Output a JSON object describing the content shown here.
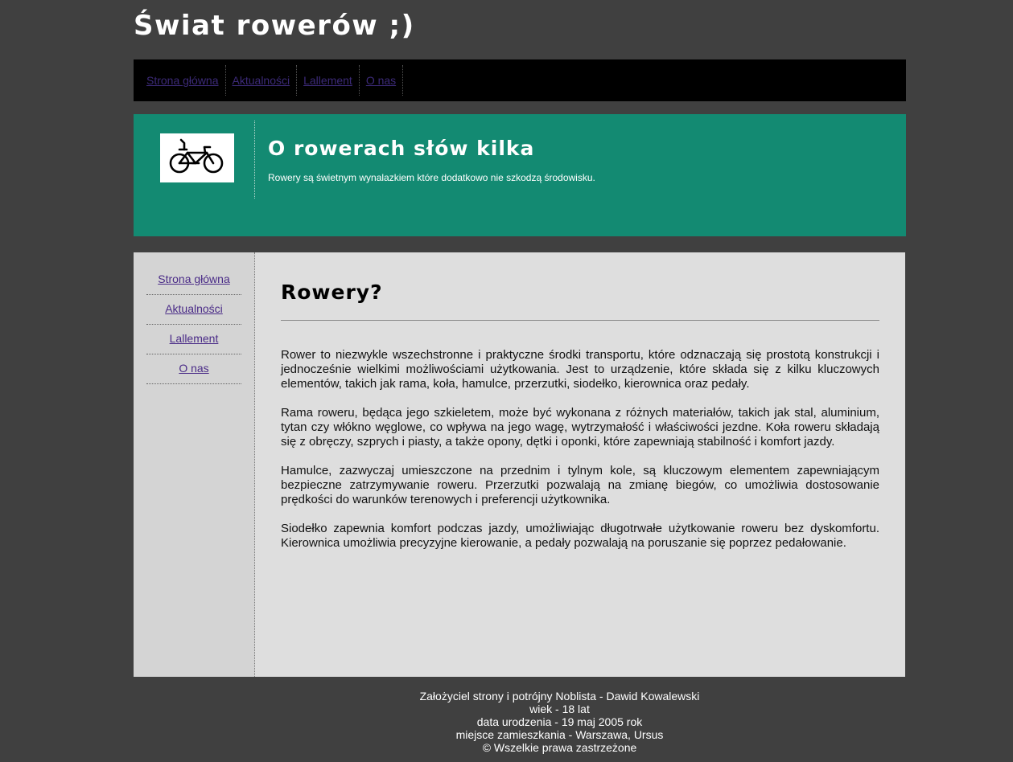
{
  "site": {
    "title": "Świat rowerów ;)"
  },
  "top_nav": {
    "items": [
      {
        "label": "Strona główna"
      },
      {
        "label": "Aktualności"
      },
      {
        "label": "Lallement"
      },
      {
        "label": "O nas"
      }
    ]
  },
  "banner": {
    "logo_icon": "bicycle-icon",
    "heading": "O rowerach słów kilka",
    "text": "Rowery są świetnym wynalazkiem które dodatkowo nie szkodzą środowisku."
  },
  "sidebar": {
    "items": [
      {
        "label": "Strona główna"
      },
      {
        "label": "Aktualności"
      },
      {
        "label": "Lallement"
      },
      {
        "label": "O nas"
      }
    ]
  },
  "main": {
    "heading": "Rowery?",
    "paragraphs": [
      "Rower to niezwykle wszechstronne i praktyczne środki transportu, które odznaczają się prostotą konstrukcji i jednocześnie wielkimi możliwościami użytkowania. Jest to urządzenie, które składa się z kilku kluczowych elementów, takich jak rama, koła, hamulce, przerzutki, siodełko, kierownica oraz pedały.",
      "Rama roweru, będąca jego szkieletem, może być wykonana z różnych materiałów, takich jak stal, aluminium, tytan czy włókno węglowe, co wpływa na jego wagę, wytrzymałość i właściwości jezdne. Koła roweru składają się z obręczy, szprych i piasty, a także opony, dętki i oponki, które zapewniają stabilność i komfort jazdy.",
      "Hamulce, zazwyczaj umieszczone na przednim i tylnym kole, są kluczowym elementem zapewniającym bezpieczne zatrzymywanie roweru. Przerzutki pozwalają na zmianę biegów, co umożliwia dostosowanie prędkości do warunków terenowych i preferencji użytkownika.",
      "Siodełko zapewnia komfort podczas jazdy, umożliwiając długotrwałe użytkowanie roweru bez dyskomfortu. Kierownica umożliwia precyzyjne kierowanie, a pedały pozwalają na poruszanie się poprzez pedałowanie."
    ]
  },
  "footer": {
    "lines": [
      "Założyciel strony i potrójny Noblista - Dawid Kowalewski",
      "wiek - 18 lat",
      "data urodzenia - 19 maj 2005 rok",
      "miejsce zamieszkania - Warszawa, Ursus",
      "© Wszelkie prawa zastrzeżone"
    ]
  },
  "colors": {
    "page_background": "#404040",
    "nav_background": "#000000",
    "banner_background": "#138a72",
    "content_background": "#dedede",
    "sidebar_background": "#d4d4d4",
    "link_color": "#4a2b87"
  }
}
